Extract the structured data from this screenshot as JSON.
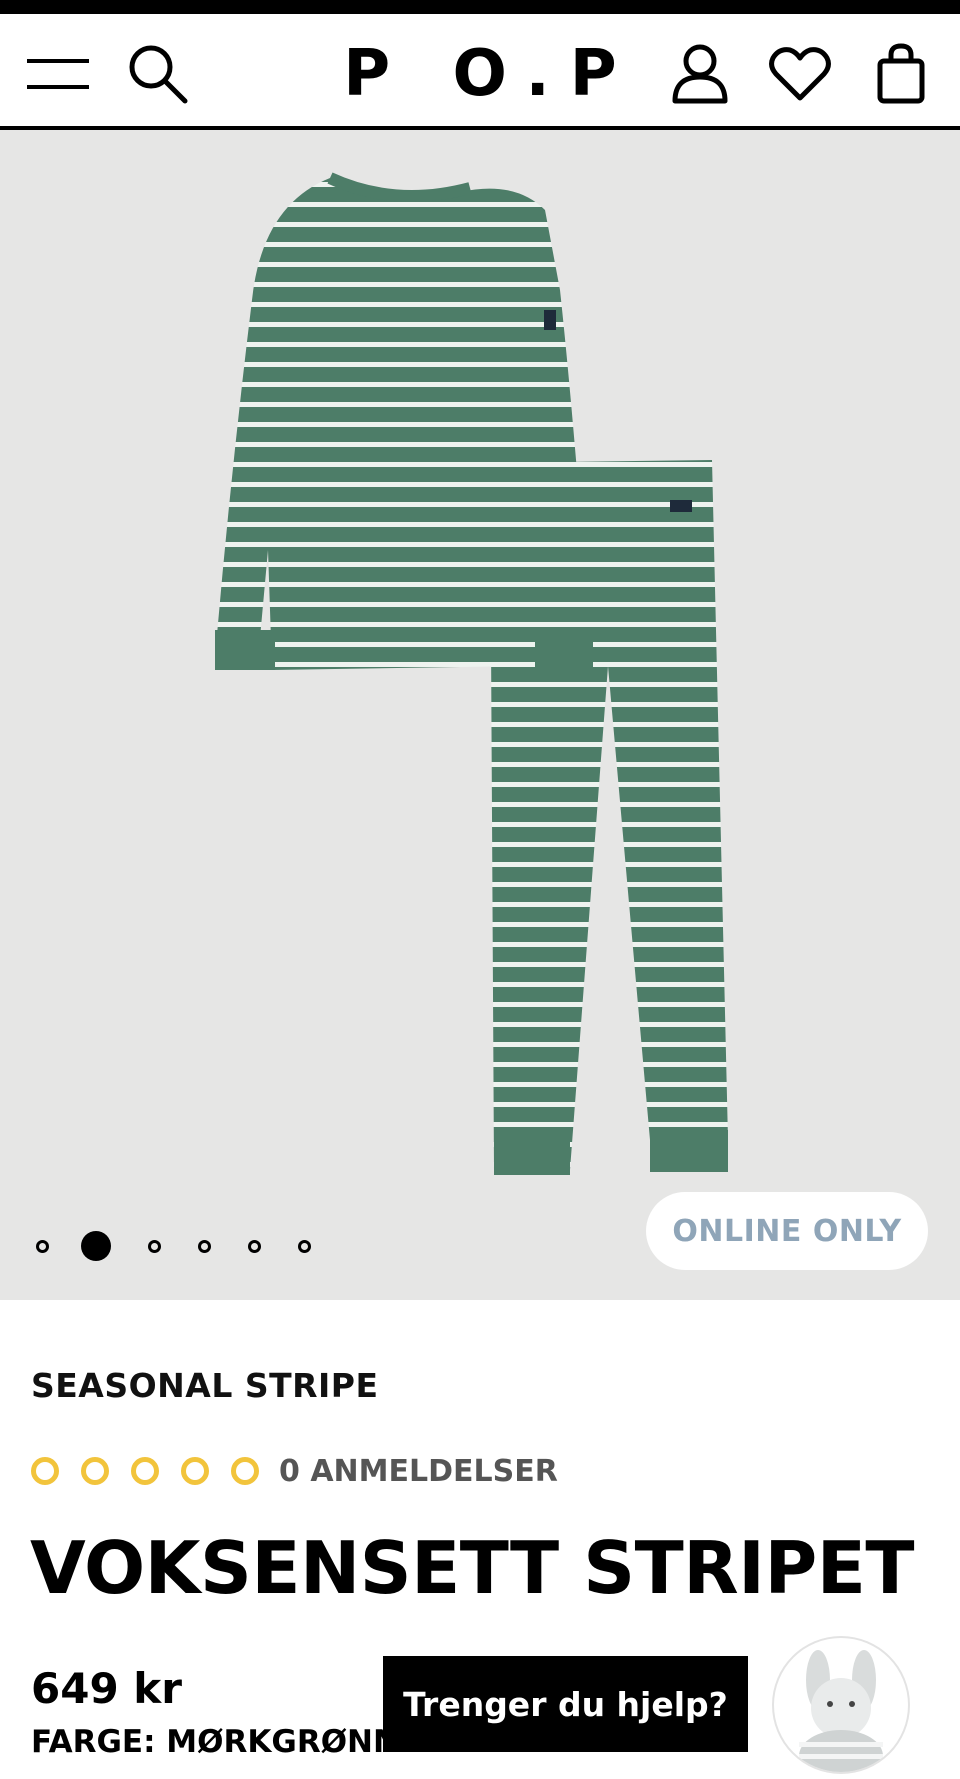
{
  "header": {
    "logo": "P O.P",
    "icons": [
      "menu-icon",
      "search-icon",
      "account-icon",
      "heart-icon",
      "bag-icon"
    ]
  },
  "gallery": {
    "slide_count": 6,
    "active_slide": 2,
    "badge": "ONLINE ONLY",
    "product_colors": {
      "green": "#4d7d68",
      "stripe": "#eef3ef",
      "background": "#e6e6e5"
    }
  },
  "product": {
    "collection": "SEASONAL STRIPE",
    "rating": {
      "stars_filled": 0,
      "stars_total": 5,
      "reviews_label": "0 ANMELDELSER"
    },
    "title": "VOKSENSETT STRIPET",
    "price": "649 kr",
    "color_label": "FARGE: MØRKGRØNN"
  },
  "help": {
    "label": "Trenger du hjelp?"
  },
  "colors": {
    "accent_star": "#f2c43c",
    "badge_text": "#8fa5b8"
  }
}
